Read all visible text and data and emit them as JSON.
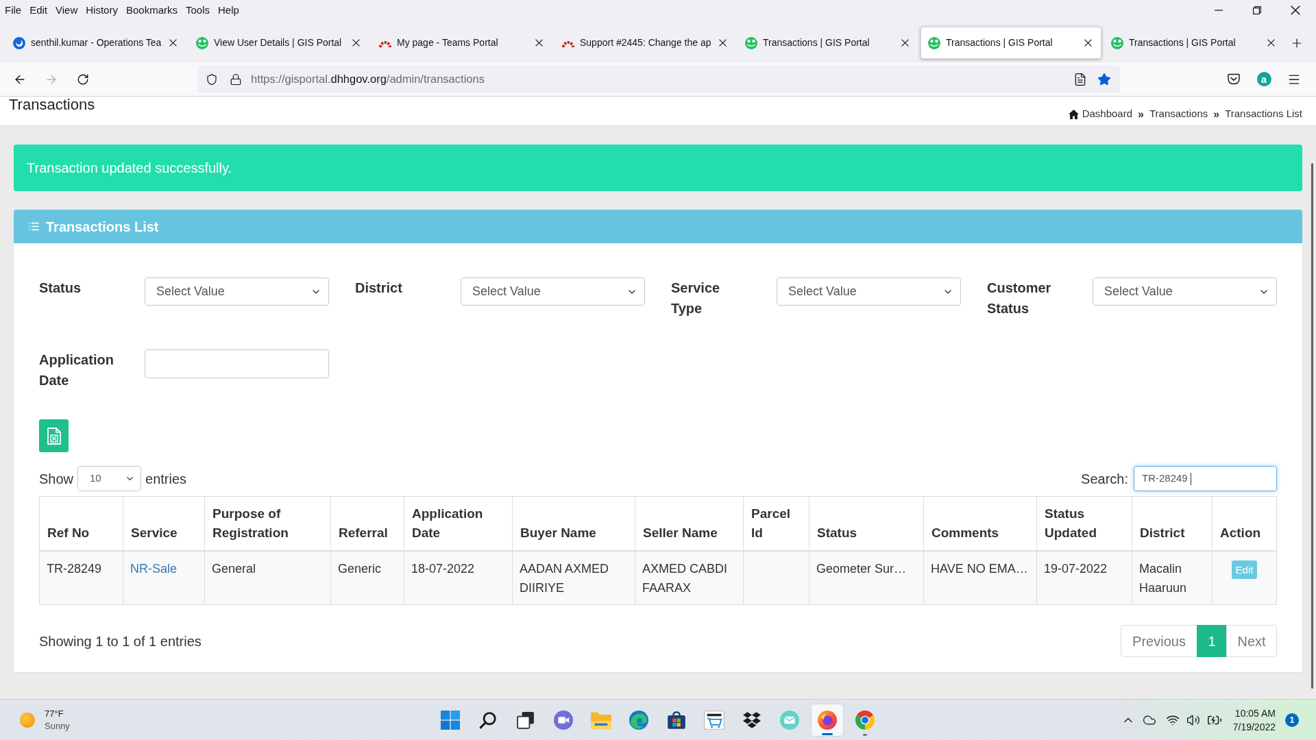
{
  "menu_bar": {
    "items": [
      "File",
      "Edit",
      "View",
      "History",
      "Bookmarks",
      "Tools",
      "Help"
    ]
  },
  "tabs": [
    {
      "title": "senthil.kumar - Operations Tea",
      "kind": "ring",
      "selected": false
    },
    {
      "title": "View User Details | GIS Portal",
      "kind": "gis",
      "selected": false
    },
    {
      "title": "My page - Teams Portal",
      "kind": "arc",
      "selected": false
    },
    {
      "title": "Support #2445: Change the ap",
      "kind": "arc",
      "selected": false
    },
    {
      "title": "Transactions | GIS Portal",
      "kind": "gis",
      "selected": false
    },
    {
      "title": "Transactions | GIS Portal",
      "kind": "gis",
      "selected": true
    },
    {
      "title": "Transactions | GIS Portal",
      "kind": "gis",
      "selected": false
    }
  ],
  "navigation": {
    "back_enabled": true,
    "forward_enabled": false
  },
  "address_bar": {
    "url": {
      "prefix": "https://gisportal.",
      "domain": "dhhgov.org",
      "path": "/admin/transactions"
    },
    "bookmarked": true
  },
  "toolbar": {
    "extension_letter": "a"
  },
  "page_header": {
    "title": "Transactions",
    "breadcrumb": [
      {
        "label": "Dashboard",
        "kind": "home"
      },
      {
        "label": "Transactions",
        "kind": "link",
        "separator": "»"
      },
      {
        "label": "Transactions List",
        "kind": "current",
        "separator": "»"
      }
    ]
  },
  "alert": {
    "message": "Transaction updated successfully."
  },
  "panel": {
    "title": "Transactions List",
    "filters": [
      {
        "label": "Status",
        "kind": "select",
        "value": "Select Value"
      },
      {
        "label": "District",
        "kind": "select",
        "value": "Select Value"
      },
      {
        "label": "Service Type",
        "kind": "select",
        "value": "Select Value"
      },
      {
        "label": "Customer Status",
        "kind": "select",
        "value": "Select Value"
      },
      {
        "label": "Application Date",
        "kind": "date"
      }
    ],
    "length_menu": {
      "before": "Show",
      "value": "10",
      "after": "entries"
    },
    "search": {
      "label": "Search:",
      "value": "TR-28249",
      "focused": true
    },
    "table": {
      "columns": [
        "Ref No",
        "Service",
        "Purpose of Registration",
        "Referral",
        "Application Date",
        "Buyer Name",
        "Seller Name",
        "Parcel Id",
        "Status",
        "Comments",
        "Status Updated",
        "District",
        "Action"
      ],
      "rows": [
        {
          "cells": [
            {
              "kind": "text",
              "text": "TR-28249"
            },
            {
              "kind": "link",
              "text": "NR-Sale"
            },
            {
              "kind": "text",
              "text": "General"
            },
            {
              "kind": "text",
              "text": "Generic"
            },
            {
              "kind": "text",
              "text": "18-07-2022"
            },
            {
              "kind": "text",
              "text": "AADAN AXMED DIIRIYE"
            },
            {
              "kind": "text",
              "text": "AXMED CABDI FAARAX"
            },
            {
              "kind": "blank"
            },
            {
              "kind": "text",
              "text": "Geometer Sur…"
            },
            {
              "kind": "text",
              "text": "HAVE NO EMA…"
            },
            {
              "kind": "text",
              "text": "19-07-2022"
            },
            {
              "kind": "text",
              "text": "Macalin Haaruun"
            },
            {
              "kind": "button",
              "text": "Edit"
            }
          ]
        }
      ]
    },
    "info": "Showing 1 to 1 of 1 entries",
    "pagination": [
      {
        "label": "Previous",
        "kind": "prev",
        "selected": false,
        "disabled": true
      },
      {
        "label": "1",
        "kind": "page",
        "selected": true,
        "disabled": false
      },
      {
        "label": "Next",
        "kind": "next",
        "selected": false,
        "disabled": true
      }
    ]
  },
  "taskbar": {
    "weather": {
      "temperature": "77°F",
      "condition": "Sunny"
    },
    "apps": [
      {
        "kind": "start",
        "running": false,
        "selected": false
      },
      {
        "kind": "search",
        "running": false,
        "selected": false
      },
      {
        "kind": "task_view",
        "running": false,
        "selected": false
      },
      {
        "kind": "chat",
        "running": false,
        "selected": false
      },
      {
        "kind": "explorer",
        "running": false,
        "selected": false
      },
      {
        "kind": "edge",
        "running": false,
        "selected": false
      },
      {
        "kind": "store",
        "running": false,
        "selected": false
      },
      {
        "kind": "amazon",
        "running": false,
        "selected": false
      },
      {
        "kind": "dropbox",
        "running": false,
        "selected": false
      },
      {
        "kind": "mail",
        "running": false,
        "selected": false
      },
      {
        "kind": "firefox",
        "running": true,
        "selected": true
      },
      {
        "kind": "chrome",
        "running": true,
        "selected": false
      }
    ],
    "clock": {
      "time": "10:05 AM",
      "date": "7/19/2022"
    },
    "notification_count": "1"
  }
}
